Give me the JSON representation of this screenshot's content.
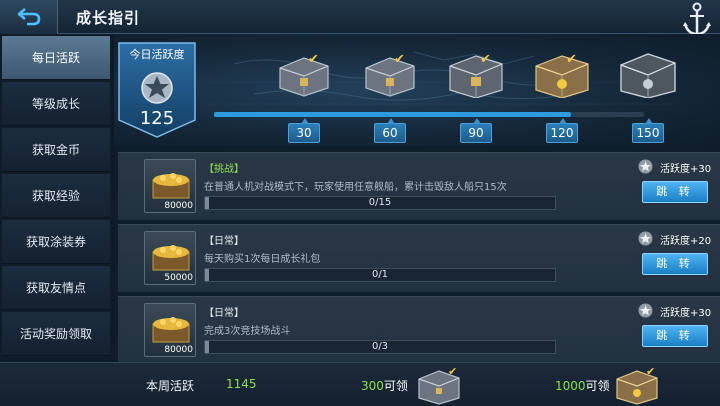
{
  "header": {
    "title": "成长指引",
    "back_icon": "back-arrow-icon",
    "anchor_icon": "anchor-icon"
  },
  "sidebar": {
    "items": [
      {
        "label": "每日活跃",
        "active": true
      },
      {
        "label": "等级成长",
        "active": false
      },
      {
        "label": "获取金币",
        "active": false
      },
      {
        "label": "获取经验",
        "active": false
      },
      {
        "label": "获取涂装券",
        "active": false
      },
      {
        "label": "获取友情点",
        "active": false
      },
      {
        "label": "活动奖励领取",
        "active": false
      }
    ]
  },
  "activity": {
    "today_label": "今日活跃度",
    "today_value": "125",
    "progress_fraction": 0.83,
    "milestones": [
      {
        "value": "30",
        "claimed": true
      },
      {
        "value": "60",
        "claimed": true
      },
      {
        "value": "90",
        "claimed": true
      },
      {
        "value": "120",
        "claimed": true
      },
      {
        "value": "150",
        "claimed": false
      }
    ]
  },
  "tasks": [
    {
      "tag": "【挑战】",
      "tag_type": "challenge",
      "desc": "在普通人机对战模式下，玩家使用任意舰船，累计击毁敌人船只15次",
      "progress": "0/15",
      "points": "活跃度+30",
      "reward": "80000",
      "button": "跳 转"
    },
    {
      "tag": "【日常】",
      "tag_type": "daily",
      "desc": "每天购买1次每日成长礼包",
      "progress": "0/1",
      "points": "活跃度+20",
      "reward": "50000",
      "button": "跳 转"
    },
    {
      "tag": "【日常】",
      "tag_type": "daily",
      "desc": "完成3次竞技场战斗",
      "progress": "0/3",
      "points": "活跃度+30",
      "reward": "80000",
      "button": "跳 转"
    }
  ],
  "bottom": {
    "weekly_label": "本周活跃",
    "weekly_value": "1145",
    "reward_a_num": "300",
    "reward_a_suffix": "可领",
    "reward_b_num": "1000",
    "reward_b_suffix": "可领"
  },
  "colors": {
    "accent_blue": "#2e9ae0",
    "challenge_green": "#8be04e",
    "check_gold": "#f1c842"
  }
}
